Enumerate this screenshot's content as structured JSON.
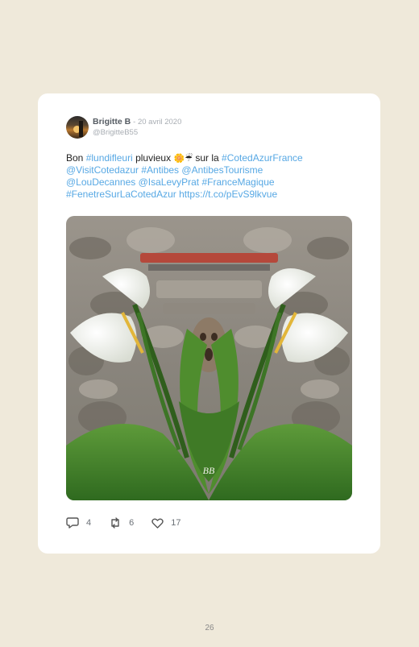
{
  "tweet": {
    "author_name": "Brigitte B",
    "date": "- 20 avril 2020",
    "handle": "@BrigitteB55",
    "text_parts": {
      "p1": "Bon ",
      "p2": "#lundifleuri",
      "p3": " pluvieux ",
      "p4": "🌼☔",
      "p5": " sur la ",
      "p6": "#CotedAzurFrance",
      "p7": "@VisitCotedazur",
      "p8": "#Antibes",
      "p9": "@AntibesTourisme",
      "p10": "@LouDecannes",
      "p11": "@IsaLevyPrat",
      "p12": "#FranceMagique",
      "p13": "#FenetreSurLaCotedAzur",
      "p14": "https://t.co/pEvS9lkvue"
    },
    "image_signature": "BB",
    "replies": "4",
    "retweets": "6",
    "likes": "17"
  },
  "page": {
    "number": "26"
  },
  "colors": {
    "background": "#efe9da",
    "card": "#ffffff",
    "link": "#57a8e4"
  },
  "icons": {
    "reply": "speech-bubble-icon",
    "retweet": "retweet-icon",
    "like": "heart-icon"
  }
}
